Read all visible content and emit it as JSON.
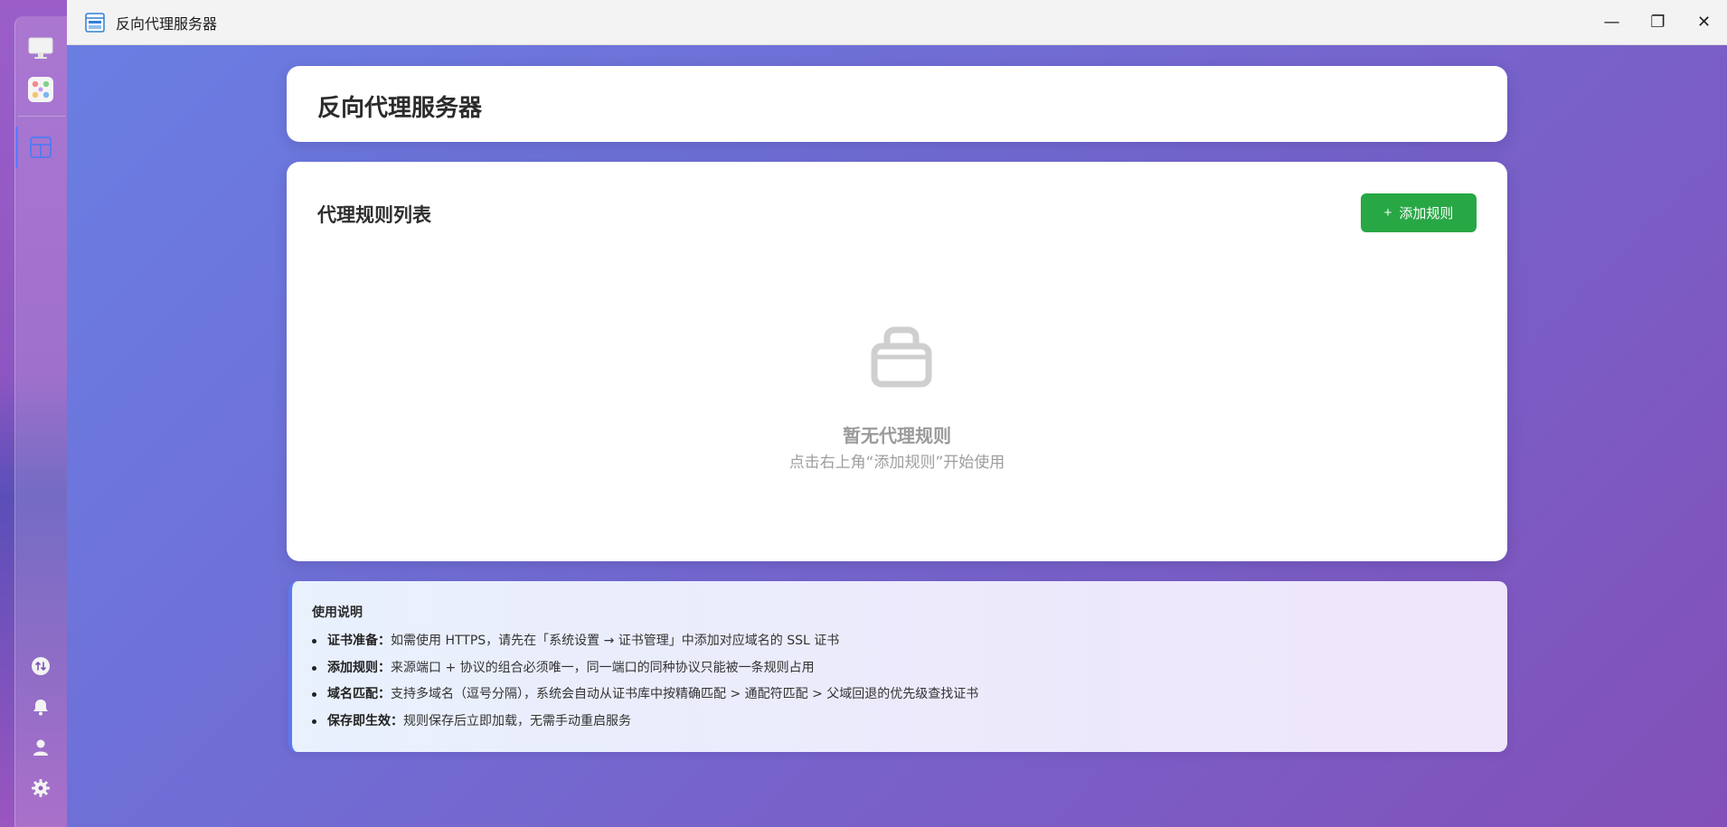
{
  "window": {
    "title": "反向代理服务器",
    "controls": {
      "minimize": "—",
      "maximize": "❐",
      "close": "✕"
    }
  },
  "dock": {
    "items": [
      {
        "name": "desktop-icon",
        "active": false
      },
      {
        "name": "apps-grid-icon",
        "active": false
      },
      {
        "name": "proxy-app-icon",
        "active": true
      }
    ],
    "bottom_items": [
      "network-icon",
      "bell-icon",
      "user-icon",
      "gear-icon"
    ]
  },
  "header": {
    "title": "反向代理服务器"
  },
  "rules": {
    "title": "代理规则列表",
    "add_button": {
      "icon": "+",
      "label": "添加规则"
    },
    "empty": {
      "icon": "lock-icon",
      "title": "暂无代理规则",
      "subtitle": "点击右上角“添加规则”开始使用"
    }
  },
  "help": {
    "title": "使用说明",
    "items": [
      {
        "key": "证书准备：",
        "text": "如需使用 HTTPS，请先在「系统设置 → 证书管理」中添加对应域名的 SSL 证书"
      },
      {
        "key": "添加规则：",
        "text": "来源端口 + 协议的组合必须唯一，同一端口的同种协议只能被一条规则占用"
      },
      {
        "key": "域名匹配：",
        "text": "支持多域名（逗号分隔），系统会自动从证书库中按精确匹配 > 通配符匹配 > 父域回退的优先级查找证书"
      },
      {
        "key": "保存即生效：",
        "text": "规则保存后立即加载，无需手动重启服务"
      }
    ]
  },
  "colors": {
    "accent_green": "#28a745",
    "accent_blue": "#5a79f0"
  }
}
